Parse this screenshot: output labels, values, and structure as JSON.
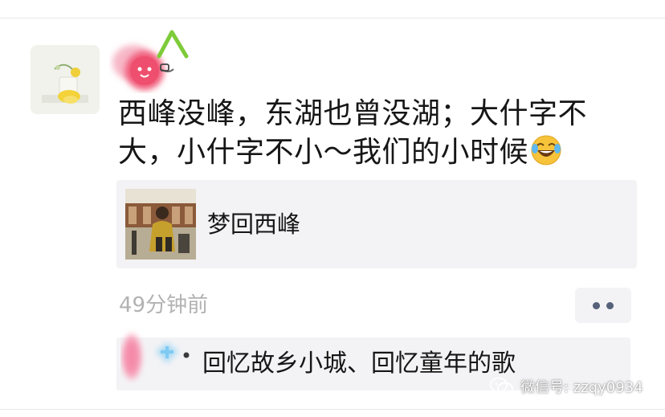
{
  "post": {
    "username": "",
    "text": "西峰没峰，东湖也曾没湖；大什字不大，小什字不小～我们的小时候",
    "emoji": "laughing-tears-emoji",
    "link": {
      "title": "梦回西峰"
    },
    "timestamp": "49分钟前",
    "more_icon": "more-dots-icon"
  },
  "comment": {
    "author": "",
    "text": "回忆故乡小城、回忆童年的歌"
  },
  "watermark": {
    "text": "微信号: zzqy0934",
    "icon": "wechat-official-account-icon"
  },
  "colors": {
    "text": "#161616",
    "secondary": "#b2b2b2",
    "card_bg": "#f3f3f5",
    "link_blue": "#56627a"
  }
}
